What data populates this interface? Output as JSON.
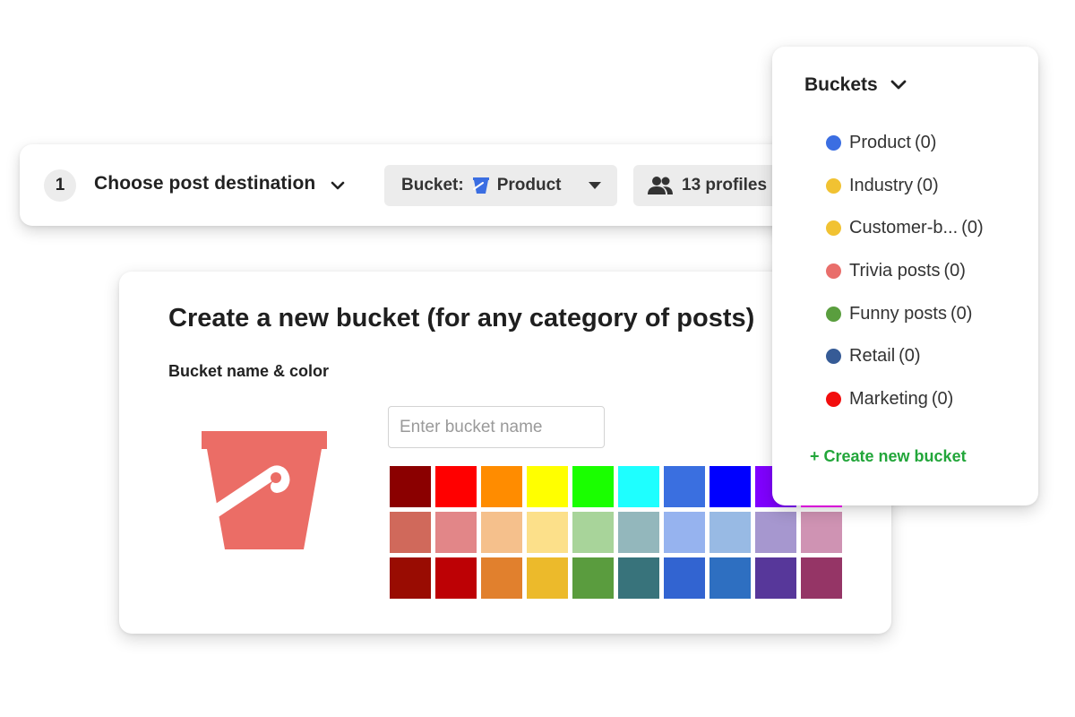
{
  "destination": {
    "step_number": "1",
    "title": "Choose post destination",
    "bucket_pill": {
      "label": "Bucket:",
      "value": "Product"
    },
    "profiles_pill": {
      "label": "13 profiles"
    }
  },
  "create_bucket": {
    "title": "Create a new bucket (for any category of posts)",
    "field_label": "Bucket name & color",
    "input": {
      "placeholder": "Enter bucket name",
      "value": ""
    },
    "selected_color": "#eb6d66",
    "swatches": [
      "#8b0000",
      "#ff0000",
      "#ff8c00",
      "#ffff00",
      "#1aff00",
      "#1effff",
      "#3a6fe0",
      "#0000ff",
      "#8000ff",
      "#ff00ff",
      "#d0695b",
      "#e28688",
      "#f5c08c",
      "#fce08a",
      "#a8d49a",
      "#93b7bc",
      "#96b3ef",
      "#98bae4",
      "#a697cf",
      "#cf93b3",
      "#990c02",
      "#bd0105",
      "#e1802d",
      "#ecba2b",
      "#5a9c3e",
      "#38737b",
      "#3264d1",
      "#2e6fc1",
      "#57379a",
      "#953566"
    ]
  },
  "buckets_menu": {
    "title": "Buckets",
    "items": [
      {
        "label": "Product",
        "count": "(0)",
        "color": "#3b6ee2"
      },
      {
        "label": "Industry",
        "count": "(0)",
        "color": "#f1c232"
      },
      {
        "label": "Customer-b...",
        "count": "(0)",
        "color": "#f1c232"
      },
      {
        "label": "Trivia posts",
        "count": "(0)",
        "color": "#e96e6b"
      },
      {
        "label": "Funny posts",
        "count": "(0)",
        "color": "#5a9e3e"
      },
      {
        "label": "Retail",
        "count": "(0)",
        "color": "#365b96"
      },
      {
        "label": "Marketing",
        "count": "(0)",
        "color": "#f20d0d"
      }
    ],
    "create_link": "+ Create new bucket"
  },
  "colors": {
    "accent_green": "#22a63a",
    "bucket_blue": "#3b6ee2",
    "pill_bg": "#ececec"
  },
  "icons": {
    "dest_chevron": "chevron-down-icon",
    "pill_caret": "caret-down-icon",
    "profiles": "people-icon",
    "bucket": "bucket-icon"
  }
}
